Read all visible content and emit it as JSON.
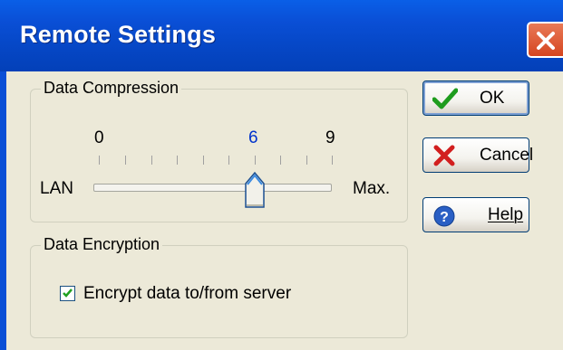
{
  "window": {
    "title": "Remote Settings"
  },
  "compression": {
    "group_label": "Data Compression",
    "tick_labels": [
      "0",
      "6",
      "9"
    ],
    "min_label": "LAN",
    "max_label": "Max.",
    "value": 6,
    "min": 0,
    "max": 9
  },
  "encryption": {
    "group_label": "Data Encryption",
    "checkbox_label": "Encrypt data to/from server",
    "checked": true
  },
  "buttons": {
    "ok": "OK",
    "cancel": "Cancel",
    "help": "Help"
  },
  "icons": {
    "close": "close-icon",
    "ok": "checkmark-icon",
    "cancel": "x-icon",
    "help": "help-icon"
  },
  "colors": {
    "titlebar": "#0a4fd6",
    "active_tick": "#0033cc",
    "close_button": "#d5451f"
  }
}
